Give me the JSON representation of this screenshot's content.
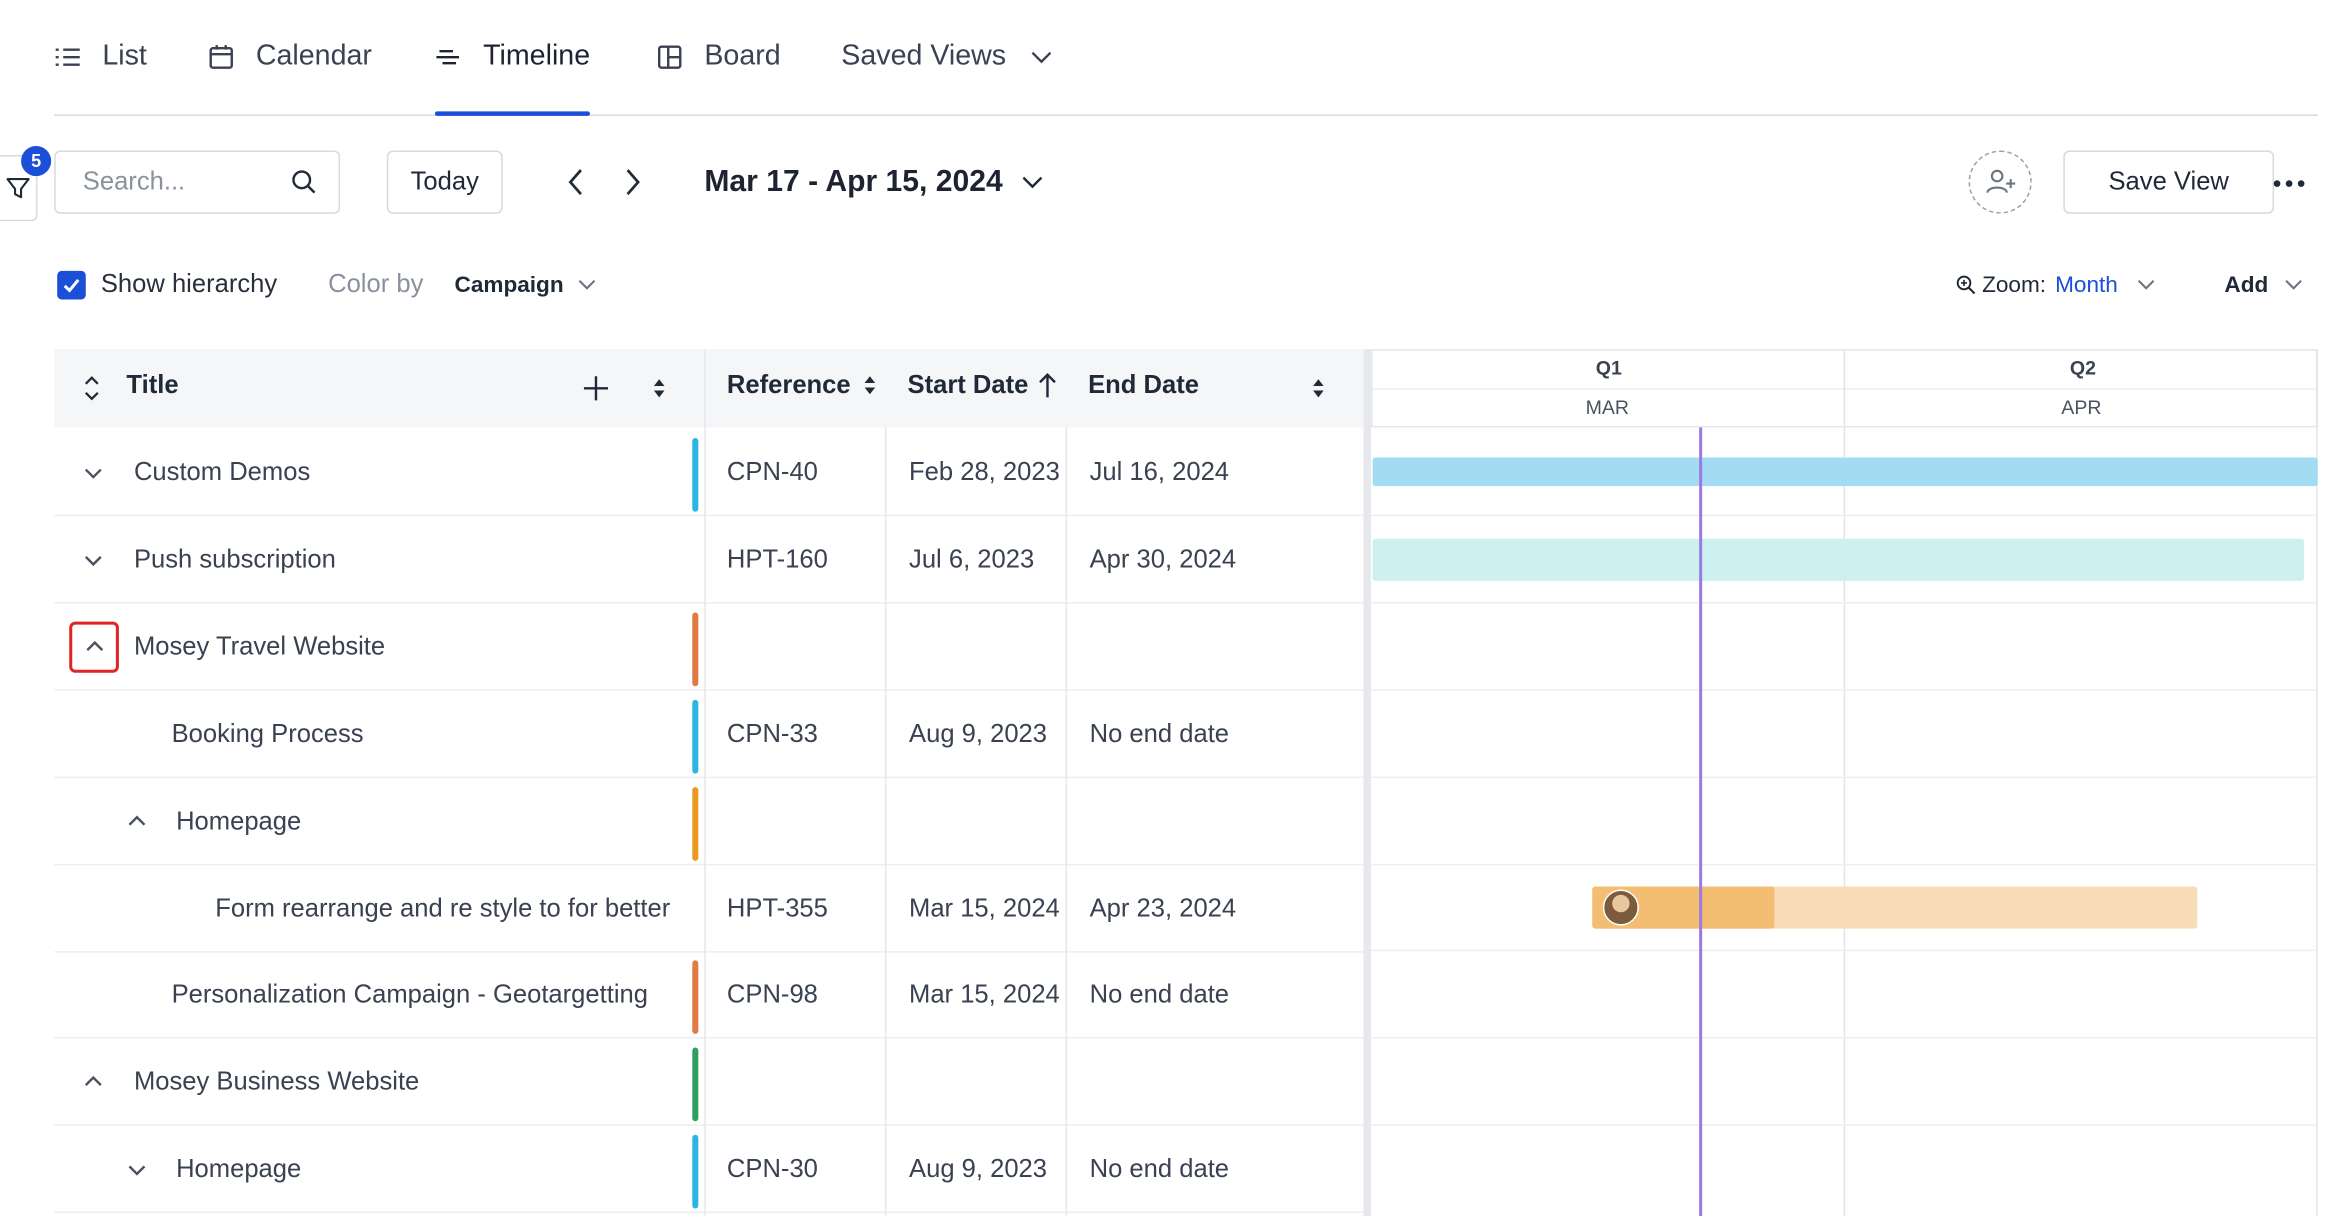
{
  "tabs": [
    {
      "label": "List",
      "icon": "list-icon"
    },
    {
      "label": "Calendar",
      "icon": "calendar-icon"
    },
    {
      "label": "Timeline",
      "icon": "timeline-icon",
      "active": true
    },
    {
      "label": "Board",
      "icon": "board-icon"
    },
    {
      "label": "Saved Views",
      "icon": "chevron-down-icon"
    }
  ],
  "toolbar": {
    "filter_count": "5",
    "search_placeholder": "Search...",
    "today_label": "Today",
    "date_range": "Mar 17 - Apr 15, 2024",
    "save_view_label": "Save View"
  },
  "options": {
    "show_hierarchy_label": "Show hierarchy",
    "show_hierarchy_checked": true,
    "color_by_label": "Color by",
    "color_by_value": "Campaign",
    "zoom_label": "Zoom:",
    "zoom_value": "Month",
    "add_label": "Add"
  },
  "columns": {
    "title": "Title",
    "reference": "Reference",
    "start_date": "Start Date",
    "end_date": "End Date"
  },
  "rows": [
    {
      "title": "Custom Demos",
      "reference": "CPN-40",
      "start": "Feb 28, 2023",
      "end": "Jul 16, 2024",
      "color": "#2bb5e0",
      "toggle": "chevron-down"
    },
    {
      "title": "Push subscription",
      "reference": "HPT-160",
      "start": "Jul 6, 2023",
      "end": "Apr 30, 2024",
      "color": "",
      "toggle": "chevron-down"
    },
    {
      "title": "Mosey Travel Website",
      "reference": "",
      "start": "",
      "end": "",
      "color": "#e07b43",
      "toggle": "chevron-up"
    },
    {
      "title": "Booking Process",
      "reference": "CPN-33",
      "start": "Aug 9, 2023",
      "end": "No end date",
      "color": "#2bb5e0",
      "toggle": ""
    },
    {
      "title": "Homepage",
      "reference": "",
      "start": "",
      "end": "",
      "color": "#e89a1c",
      "toggle": "chevron-up"
    },
    {
      "title": "Form rearrange and re style to for better",
      "reference": "HPT-355",
      "start": "Mar 15, 2024",
      "end": "Apr 23, 2024",
      "color": "",
      "toggle": ""
    },
    {
      "title": "Personalization Campaign - Geotargetting",
      "reference": "CPN-98",
      "start": "Mar 15, 2024",
      "end": "No end date",
      "color": "#e07b43",
      "toggle": ""
    },
    {
      "title": "Mosey Business Website",
      "reference": "",
      "start": "",
      "end": "",
      "color": "#2f9e5e",
      "toggle": "chevron-up"
    },
    {
      "title": "Homepage",
      "reference": "CPN-30",
      "start": "Aug 9, 2023",
      "end": "No end date",
      "color": "#2bb5e0",
      "toggle": "chevron-down"
    }
  ],
  "timeline": {
    "quarters": [
      "Q1",
      "Q2"
    ],
    "months": [
      "MAR",
      "APR"
    ]
  },
  "colors": {
    "accent": "#1b4fd8",
    "bar_blue": "#a3dcf2",
    "bar_teal": "#cdf0f1",
    "bar_orange": "#f3bd72",
    "bar_orange_light": "#f8dcb8",
    "today_line": "#9a7ae0"
  }
}
